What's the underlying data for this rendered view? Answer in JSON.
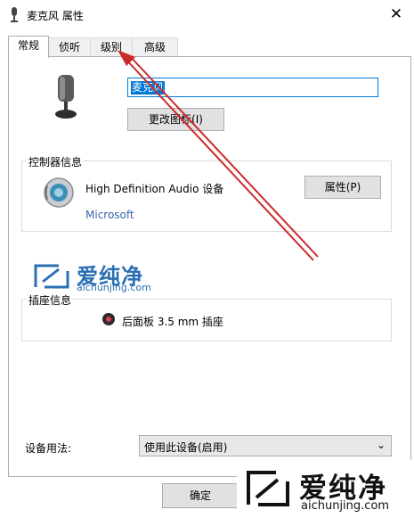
{
  "window": {
    "title": "麦克风 属性",
    "close_glyph": "✕"
  },
  "tabs": [
    {
      "label": "常规",
      "active": true
    },
    {
      "label": "侦听",
      "active": false
    },
    {
      "label": "级别",
      "active": false
    },
    {
      "label": "高级",
      "active": false
    }
  ],
  "general": {
    "device_name_value": "麦克风",
    "change_icon_label": "更改图标(I)"
  },
  "controller": {
    "group_label": "控制器信息",
    "device_name": "High Definition Audio 设备",
    "vendor": "Microsoft",
    "properties_label": "属性(P)"
  },
  "jack": {
    "group_label": "插座信息",
    "text": "后面板 3.5 mm 插座"
  },
  "usage": {
    "label": "设备用法:",
    "selected": "使用此设备(启用)"
  },
  "footer": {
    "ok_label": "确定"
  },
  "watermark": {
    "text": "爱纯净",
    "url": "aichunjing.com"
  },
  "colors": {
    "selection": "#0078d7",
    "arrow": "#cc2a2a",
    "link": "#3366aa",
    "watermark_blue": "#2a6fb3"
  }
}
